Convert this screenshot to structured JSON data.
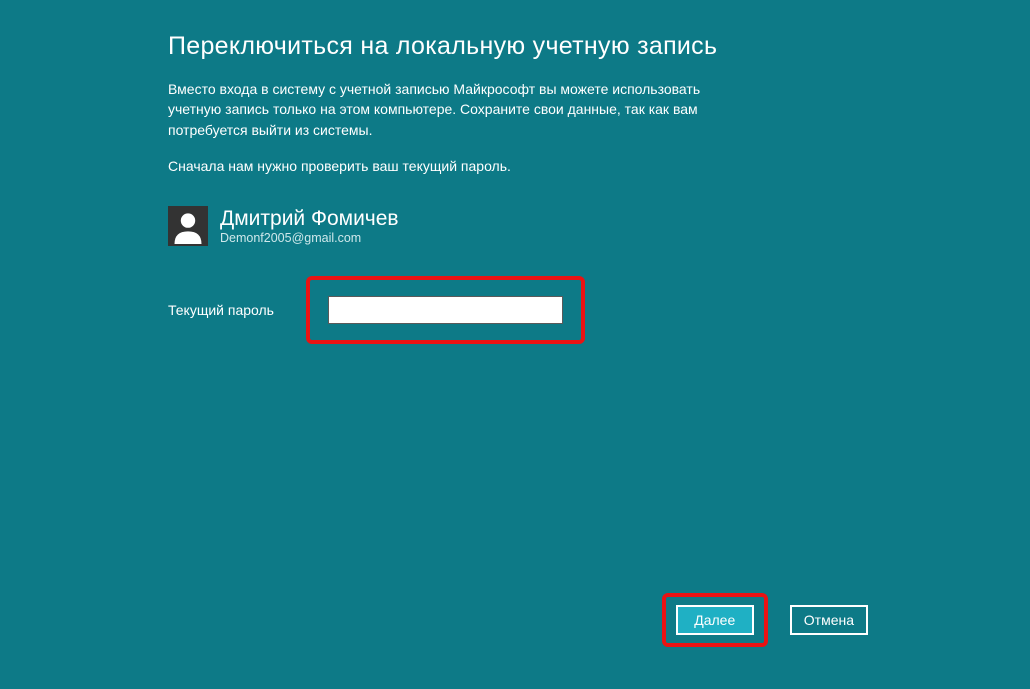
{
  "title": "Переключиться на локальную учетную запись",
  "description": "Вместо входа в систему с учетной записью Майкрософт вы можете использовать учетную запись только на этом компьютере. Сохраните свои данные, так как вам потребуется выйти из системы.",
  "instruction": "Сначала нам нужно проверить ваш текущий пароль.",
  "user": {
    "name": "Дмитрий Фомичев",
    "email": "Demonf2005@gmail.com"
  },
  "form": {
    "password_label": "Текущий пароль",
    "password_value": ""
  },
  "buttons": {
    "next": "Далее",
    "cancel": "Отмена"
  }
}
